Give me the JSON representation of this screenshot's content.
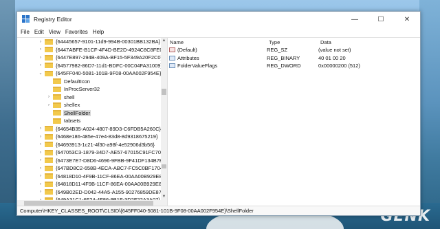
{
  "window": {
    "title": "Registry Editor",
    "controls": {
      "minimize": "—",
      "maximize": "☐",
      "close": "✕"
    }
  },
  "menu": [
    "File",
    "Edit",
    "View",
    "Favorites",
    "Help"
  ],
  "tree": {
    "rows": [
      {
        "label": "{64445657-9101-11d9-994B-00301BB132BA}",
        "indent": 2,
        "expander": "›",
        "selected": false
      },
      {
        "label": "{6447ABFE-B1CF-4F4D-BE2D-4924C8C8FE0}",
        "indent": 2,
        "expander": "›",
        "selected": false
      },
      {
        "label": "{6447E897-294B-409A-BF15-5F349A20F2C0}",
        "indent": 2,
        "expander": "›",
        "selected": false
      },
      {
        "label": "{64577982-86D7-11d1-BDFC-00C04FA31009}",
        "indent": 2,
        "expander": "›",
        "selected": false
      },
      {
        "label": "{645FF040-5081-101B-9F08-00AA002F954E}",
        "indent": 2,
        "expander": "⌄",
        "selected": false
      },
      {
        "label": "DefaultIcon",
        "indent": 3,
        "expander": "",
        "selected": false
      },
      {
        "label": "InProcServer32",
        "indent": 3,
        "expander": "",
        "selected": false
      },
      {
        "label": "shell",
        "indent": 3,
        "expander": "›",
        "selected": false
      },
      {
        "label": "shellex",
        "indent": 3,
        "expander": "›",
        "selected": false
      },
      {
        "label": "ShellFolder",
        "indent": 3,
        "expander": "",
        "selected": true
      },
      {
        "label": "tabsets",
        "indent": 3,
        "expander": "",
        "selected": false
      },
      {
        "label": "{64654B35-A024-4807-89D3-C6FDB5A260C}",
        "indent": 2,
        "expander": "›",
        "selected": false
      },
      {
        "label": "{6468e186-485e-47e4-83d8-8d9318675219}",
        "indent": 2,
        "expander": "›",
        "selected": false
      },
      {
        "label": "{64693913-1c21-4f30-a98f-4e52906d3b56}",
        "indent": 2,
        "expander": "›",
        "selected": false
      },
      {
        "label": "{647053C3-1879-34D7-AE57-67015C91FC70}",
        "indent": 2,
        "expander": "›",
        "selected": false
      },
      {
        "label": "{6473E7E7-D8D6-4696-9FBB-9F41DF134B7B}",
        "indent": 2,
        "expander": "›",
        "selected": false
      },
      {
        "label": "{647BD8C2-658B-4ECA-ABC7-FC5C0BF1704}",
        "indent": 2,
        "expander": "›",
        "selected": false
      },
      {
        "label": "{64818D10-4F9B-11CF-86EA-00AA00B929E8}",
        "indent": 2,
        "expander": "›",
        "selected": false
      },
      {
        "label": "{64818D11-4F9B-11CF-86EA-00AA00B929E8}",
        "indent": 2,
        "expander": "›",
        "selected": false
      },
      {
        "label": "{649B02ED-D042-44A5-A155-90276859DE87}",
        "indent": 2,
        "expander": "›",
        "selected": false
      },
      {
        "label": "{649A31C1-6F24-4F86-9B1F-3D2F22A3A07}",
        "indent": 2,
        "expander": "›",
        "selected": false
      }
    ]
  },
  "values": {
    "headers": {
      "name": "Name",
      "type": "Type",
      "data": "Data"
    },
    "rows": [
      {
        "name": "(Default)",
        "type": "REG_SZ",
        "data": "(value not set)",
        "icon": "string-value-icon"
      },
      {
        "name": "Attributes",
        "type": "REG_BINARY",
        "data": "40 01 00 20",
        "icon": "binary-value-icon"
      },
      {
        "name": "FolderValueFlags",
        "type": "REG_DWORD",
        "data": "0x00000200 (512)",
        "icon": "binary-value-icon"
      }
    ]
  },
  "status": {
    "path": "Computer\\HKEY_CLASSES_ROOT\\CLSID\\{645FF040-5081-101B-9F08-00AA002F954E}\\ShellFolder"
  },
  "watermark": "GENK"
}
